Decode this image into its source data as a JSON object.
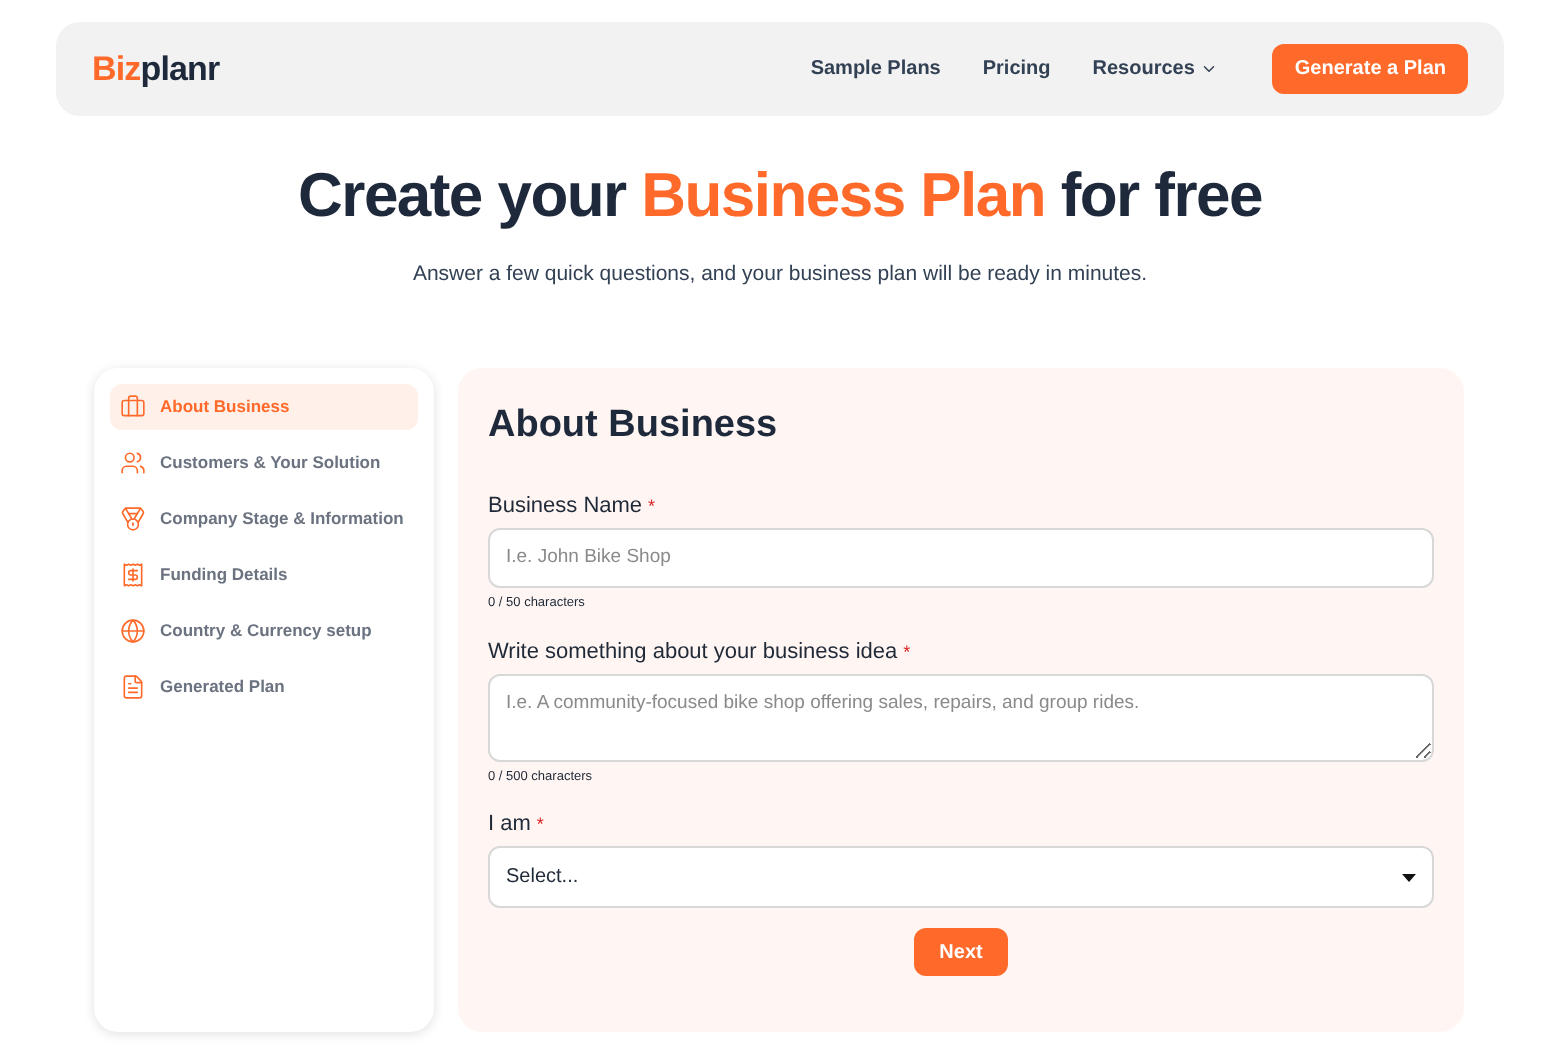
{
  "navbar": {
    "logo": {
      "accent": "Biz",
      "rest": "planr"
    },
    "links": [
      {
        "label": "Sample Plans",
        "dropdown": false
      },
      {
        "label": "Pricing",
        "dropdown": false
      },
      {
        "label": "Resources",
        "dropdown": true
      }
    ],
    "cta": "Generate a Plan"
  },
  "hero": {
    "headline": {
      "before": "Create your ",
      "accent": "Business Plan",
      "after": " for free"
    },
    "subtitle": "Answer a few quick questions, and your business plan will be ready in minutes."
  },
  "sidebar": {
    "items": [
      {
        "kind": "briefcase",
        "label": "About Business",
        "selected": true
      },
      {
        "kind": "users",
        "label": "Customers & Your Solution",
        "selected": false
      },
      {
        "kind": "medal",
        "label": "Company Stage & Information",
        "selected": false
      },
      {
        "kind": "receipt",
        "label": "Funding Details",
        "selected": false
      },
      {
        "kind": "globe",
        "label": "Country & Currency setup",
        "selected": false
      },
      {
        "kind": "pdf",
        "label": "Generated Plan",
        "selected": false
      }
    ]
  },
  "form": {
    "title": "About Business",
    "fields": [
      {
        "kind": "input",
        "label": "Business Name",
        "required_mark": "*",
        "placeholder": "I.e. John Bike Shop",
        "counter": "0 / 50 characters"
      },
      {
        "kind": "textarea",
        "label": "Write something about your business idea",
        "required_mark": "*",
        "placeholder": "I.e. A community-focused bike shop offering sales, repairs, and group rides.",
        "counter": "0 / 500 characters"
      },
      {
        "kind": "select",
        "label": "I am",
        "required_mark": "*",
        "value": "Select..."
      }
    ],
    "submit": "Next"
  }
}
